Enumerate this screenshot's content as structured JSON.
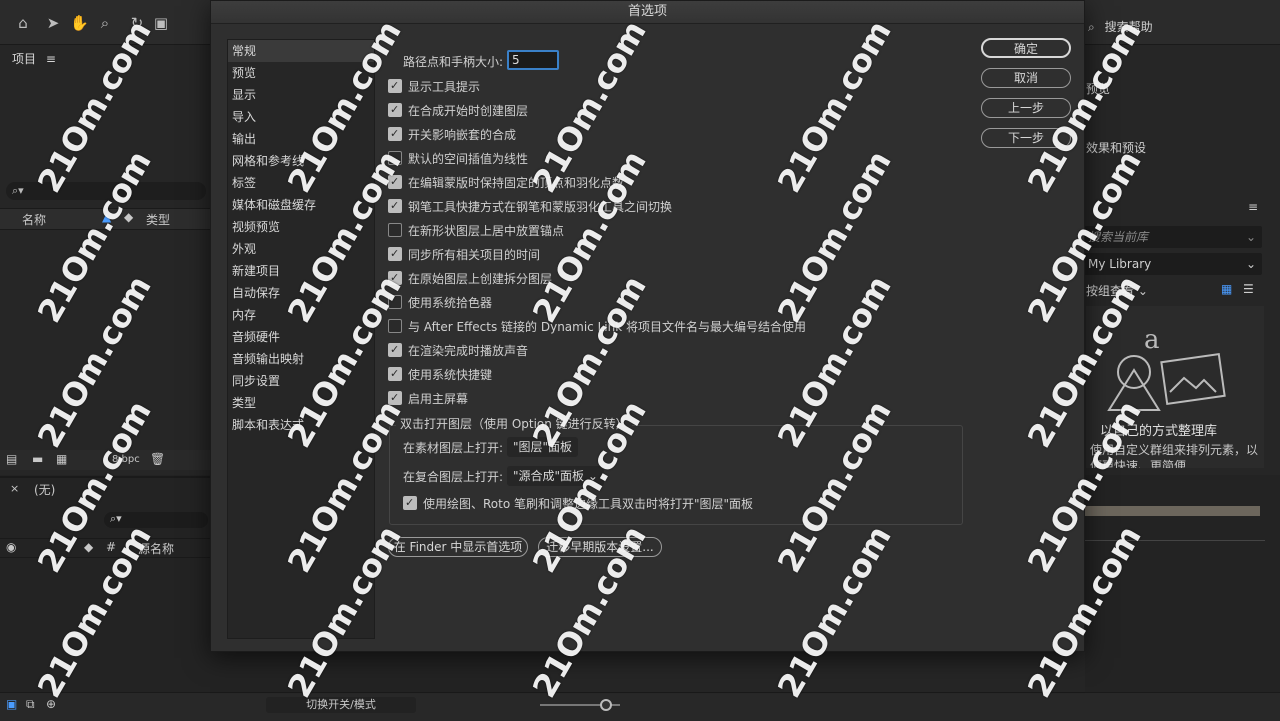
{
  "app": {
    "search_help": "搜索帮助",
    "left_panel": {
      "title": "项目",
      "col_name": "名称",
      "col_type": "类型",
      "bpc": "8 bpc"
    },
    "timeline": {
      "tab": "(无)",
      "col_hash": "#",
      "col_source": "源名称",
      "footer_label": "切换开关/模式"
    },
    "right_panel": {
      "items": [
        "预览",
        "效果和预设"
      ],
      "search_placeholder": "搜索当前库",
      "library": "My Library",
      "view_by": "按组查看",
      "lib_heading": "以自己的方式整理库",
      "lib_text": "使用自定义群组来排列元素，以便更快速、更简便"
    }
  },
  "dialog": {
    "title": "首选项",
    "categories": [
      "常规",
      "预览",
      "显示",
      "导入",
      "输出",
      "网格和参考线",
      "标签",
      "媒体和磁盘缓存",
      "视频预览",
      "外观",
      "新建项目",
      "自动保存",
      "内存",
      "音频硬件",
      "音频输出映射",
      "同步设置",
      "类型",
      "脚本和表达式"
    ],
    "handle_size_label": "路径点和手柄大小:",
    "handle_size_value": "5",
    "checkboxes": [
      {
        "label": "显示工具提示",
        "checked": true
      },
      {
        "label": "在合成开始时创建图层",
        "checked": true
      },
      {
        "label": "开关影响嵌套的合成",
        "checked": true
      },
      {
        "label": "默认的空间插值为线性",
        "checked": false
      },
      {
        "label": "在编辑蒙版时保持固定的顶点和羽化点数",
        "checked": true
      },
      {
        "label": "钢笔工具快捷方式在钢笔和蒙版羽化工具之间切换",
        "checked": true
      },
      {
        "label": "在新形状图层上居中放置锚点",
        "checked": false
      },
      {
        "label": "同步所有相关项目的时间",
        "checked": true
      },
      {
        "label": "在原始图层上创建拆分图层",
        "checked": true
      },
      {
        "label": "使用系统拾色器",
        "checked": false
      },
      {
        "label": "与 After Effects 链接的 Dynamic Link 将项目文件名与最大编号结合使用",
        "checked": false
      },
      {
        "label": "在渲染完成时播放声音",
        "checked": true
      },
      {
        "label": "使用系统快捷键",
        "checked": true
      },
      {
        "label": "启用主屏幕",
        "checked": true
      }
    ],
    "group": {
      "legend": "双击打开图层（使用 Option 键进行反转）",
      "footage_label": "在素材图层上打开:",
      "footage_value": "\"图层\"面板",
      "comp_label": "在复合图层上打开:",
      "comp_value": "\"源合成\"面板",
      "paint_checkbox": "使用绘图、Roto 笔刷和调整边缘工具双击时将打开\"图层\"面板"
    },
    "reveal_finder_button": "在 Finder 中显示首选项",
    "migrate_button": "迁移早期版本设置...",
    "ok_button": "确定",
    "cancel_button": "取消",
    "prev_button": "上一步",
    "next_button": "下一步"
  },
  "watermark": "21Om.com"
}
